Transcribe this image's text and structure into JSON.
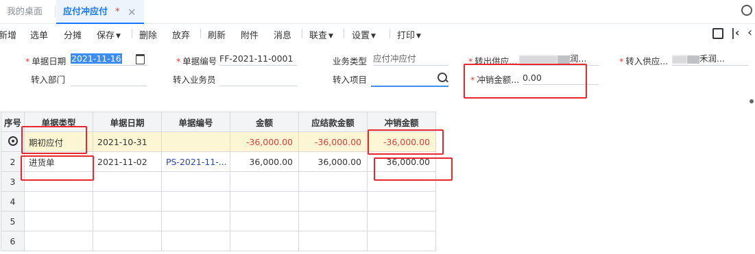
{
  "tabs": {
    "home": "我的桌面",
    "active": "应付冲应付",
    "active_modified": "*",
    "close": "✕"
  },
  "toolbar": {
    "items": [
      "新增",
      "选单",
      "分摊",
      "保存",
      "删除",
      "放弃",
      "刷新",
      "附件",
      "消息",
      "联查",
      "设置",
      "打印"
    ],
    "dropdown_items": [
      "保存",
      "联查",
      "设置",
      "打印"
    ]
  },
  "form": {
    "doc_date_label": "单据日期",
    "doc_date_value": "2021-11-16",
    "doc_no_label": "单据编号",
    "doc_no_value": "FF-2021-11-0001",
    "biz_type_label": "业务类型",
    "biz_type_value": "应付冲应付",
    "out_supplier_label": "转出供应...",
    "out_supplier_value_suffix": "润...",
    "in_supplier_label": "转入供应...",
    "in_supplier_value_suffix": "禾润...",
    "in_dept_label": "转入部门",
    "in_dept_value": "",
    "in_staff_label": "转入业务员",
    "in_staff_value": "",
    "in_project_label": "转入项目",
    "in_project_value": "",
    "writeoff_amount_label": "冲销金额...",
    "writeoff_amount_value": "0.00"
  },
  "grid": {
    "columns": [
      "序号",
      "单据类型",
      "单据日期",
      "单据编号",
      "金额",
      "应结款金额",
      "冲销金额"
    ],
    "rows": [
      {
        "index": "",
        "type": "期初应付",
        "date": "2021-10-31",
        "no": "",
        "amount": "-36,000.00",
        "due": "-36,000.00",
        "writeoff": "-36,000.00"
      },
      {
        "index": "2",
        "type": "进货单",
        "date": "2021-11-02",
        "no": "PS-2021-11-...",
        "amount": "36,000.00",
        "due": "36,000.00",
        "writeoff": "36,000.00"
      }
    ],
    "empty_rows": [
      "3",
      "4",
      "5",
      "6"
    ]
  },
  "colors": {
    "accent": "#1677ff",
    "negative": "#e53935",
    "highlight_row": "#fdf6d5",
    "annotation_box": "#e8262b"
  }
}
